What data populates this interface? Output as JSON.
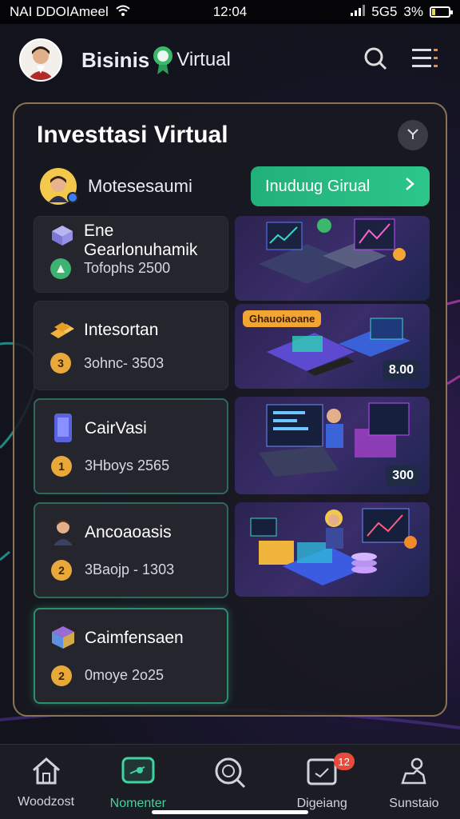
{
  "status_bar": {
    "carrier": "NAI DDOIAmeel",
    "time": "12:04",
    "signal": "5G5",
    "battery": "3%"
  },
  "header": {
    "title_bold": "Bisinis",
    "title_rest": "Virtual",
    "avatar_icon": "user-avatar",
    "search_icon": "search-icon",
    "menu_icon": "menu-icon"
  },
  "card": {
    "title": "Investtasi Virtual",
    "toggle_icon": "chevron-down-icon",
    "user_name": "Motesesaumi",
    "cta_label": "Inuduug Girual",
    "items": [
      {
        "name": "Ene Gearlonuhamik",
        "meta": "Tofophs 2500",
        "coin": "",
        "icon": "cube-icon",
        "coin_color": "#3cb371"
      },
      {
        "name": "Intesortan",
        "meta": "3ohnc- 3503",
        "coin": "3",
        "icon": "gold-bars-icon",
        "coin_color": "#e8a93a"
      },
      {
        "name": "CairVasi",
        "meta": "3Hboys 2565",
        "coin": "1",
        "icon": "phone-icon",
        "coin_color": "#e8a93a"
      },
      {
        "name": "Ancoaoasis",
        "meta": "3Baojp - 1303",
        "coin": "2",
        "icon": "person-icon",
        "coin_color": "#e8a93a"
      },
      {
        "name": "Caimfensaen",
        "meta": "0moye 2o25",
        "coin": "2",
        "icon": "crate-icon",
        "coin_color": "#e8a93a"
      }
    ],
    "images": [
      {
        "tag": ""
      },
      {
        "label": "Ghauoiaoane",
        "tag": "8.00"
      },
      {
        "tag": "300"
      },
      {
        "tag": ""
      }
    ]
  },
  "nav": {
    "items": [
      {
        "label": "Woodzost",
        "icon": "home-icon"
      },
      {
        "label": "Nomenter",
        "icon": "wallet-icon"
      },
      {
        "label": "",
        "icon": "search-icon"
      },
      {
        "label": "Digeiang",
        "icon": "inbox-icon",
        "badge": "12"
      },
      {
        "label": "Sunstaio",
        "icon": "profile-icon"
      }
    ]
  },
  "colors": {
    "accent": "#2cc68a",
    "card_border": "#8b7456",
    "badge": "#e64b3c"
  }
}
